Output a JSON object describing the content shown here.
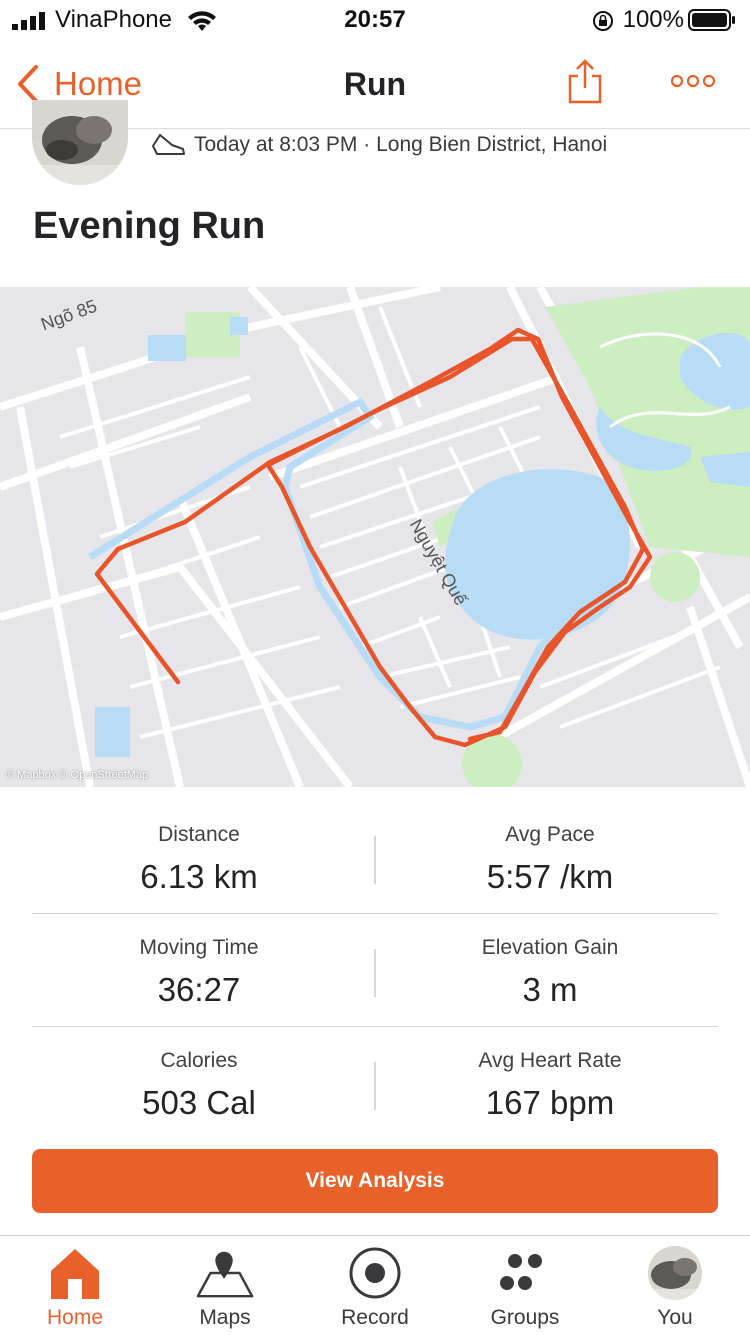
{
  "status_bar": {
    "carrier": "VinaPhone",
    "time": "20:57",
    "battery": "100%"
  },
  "nav": {
    "back_label": "Home",
    "title": "Run"
  },
  "activity": {
    "meta": "Today at 8:03 PM · Long Bien District, Hanoi",
    "title": "Evening Run"
  },
  "map": {
    "street_label_1": "Ngõ 85",
    "street_label_2": "Nguyệt Quế",
    "attribution": "© Mapbox © OpenStreetMap"
  },
  "stats": [
    {
      "label": "Distance",
      "value": "6.13 km"
    },
    {
      "label": "Avg Pace",
      "value": "5:57 /km"
    },
    {
      "label": "Moving Time",
      "value": "36:27"
    },
    {
      "label": "Elevation Gain",
      "value": "3 m"
    },
    {
      "label": "Calories",
      "value": "503 Cal"
    },
    {
      "label": "Avg Heart Rate",
      "value": "167 bpm"
    }
  ],
  "view_analysis_label": "View Analysis",
  "tabs": [
    {
      "label": "Home",
      "icon": "home-icon",
      "active": true
    },
    {
      "label": "Maps",
      "icon": "map-pin-icon",
      "active": false
    },
    {
      "label": "Record",
      "icon": "record-icon",
      "active": false
    },
    {
      "label": "Groups",
      "icon": "groups-icon",
      "active": false
    },
    {
      "label": "You",
      "icon": "avatar",
      "active": false
    }
  ],
  "colors": {
    "accent": "#e8602a",
    "route": "#e8552a",
    "water": "#b8dcf5",
    "park": "#cdeec0"
  }
}
